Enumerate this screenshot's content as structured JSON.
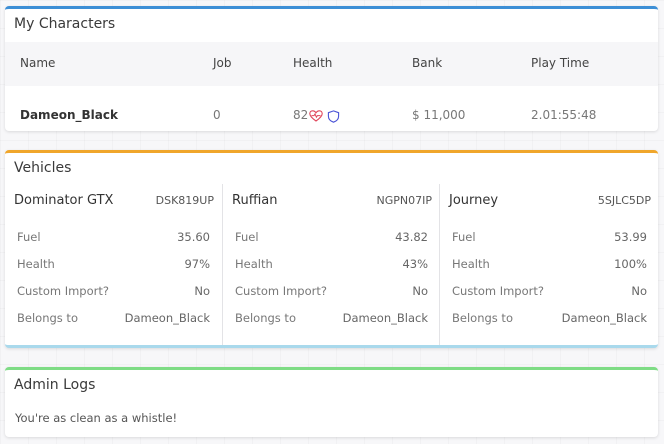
{
  "characters": {
    "title": "My Characters",
    "accent": "#3d8fd6",
    "columns": [
      "Name",
      "Job",
      "Health",
      "Bank",
      "Play Time"
    ],
    "rows": [
      {
        "name": "Dameon_Black",
        "job": "0",
        "health": "82",
        "health_icons": [
          "heartbeat-icon",
          "shield-icon"
        ],
        "bank": "$ 11,000",
        "play_time": "2.01:55:48"
      }
    ]
  },
  "vehicles": {
    "title": "Vehicles",
    "accent": "#f0a62b",
    "items": [
      {
        "name": "Dominator GTX",
        "plate": "DSK819UP",
        "fields": [
          {
            "label": "Fuel",
            "value": "35.60"
          },
          {
            "label": "Health",
            "value": "97%"
          },
          {
            "label": "Custom Import?",
            "value": "No"
          },
          {
            "label": "Belongs to",
            "value": "Dameon_Black"
          }
        ]
      },
      {
        "name": "Ruffian",
        "plate": "NGPN07IP",
        "fields": [
          {
            "label": "Fuel",
            "value": "43.82"
          },
          {
            "label": "Health",
            "value": "43%"
          },
          {
            "label": "Custom Import?",
            "value": "No"
          },
          {
            "label": "Belongs to",
            "value": "Dameon_Black"
          }
        ]
      },
      {
        "name": "Journey",
        "plate": "5SJLC5DP",
        "fields": [
          {
            "label": "Fuel",
            "value": "53.99"
          },
          {
            "label": "Health",
            "value": "100%"
          },
          {
            "label": "Custom Import?",
            "value": "No"
          },
          {
            "label": "Belongs to",
            "value": "Dameon_Black"
          }
        ]
      }
    ]
  },
  "admin_logs": {
    "title": "Admin Logs",
    "accent": "#7edc85",
    "message": "You're as clean as a whistle!"
  }
}
